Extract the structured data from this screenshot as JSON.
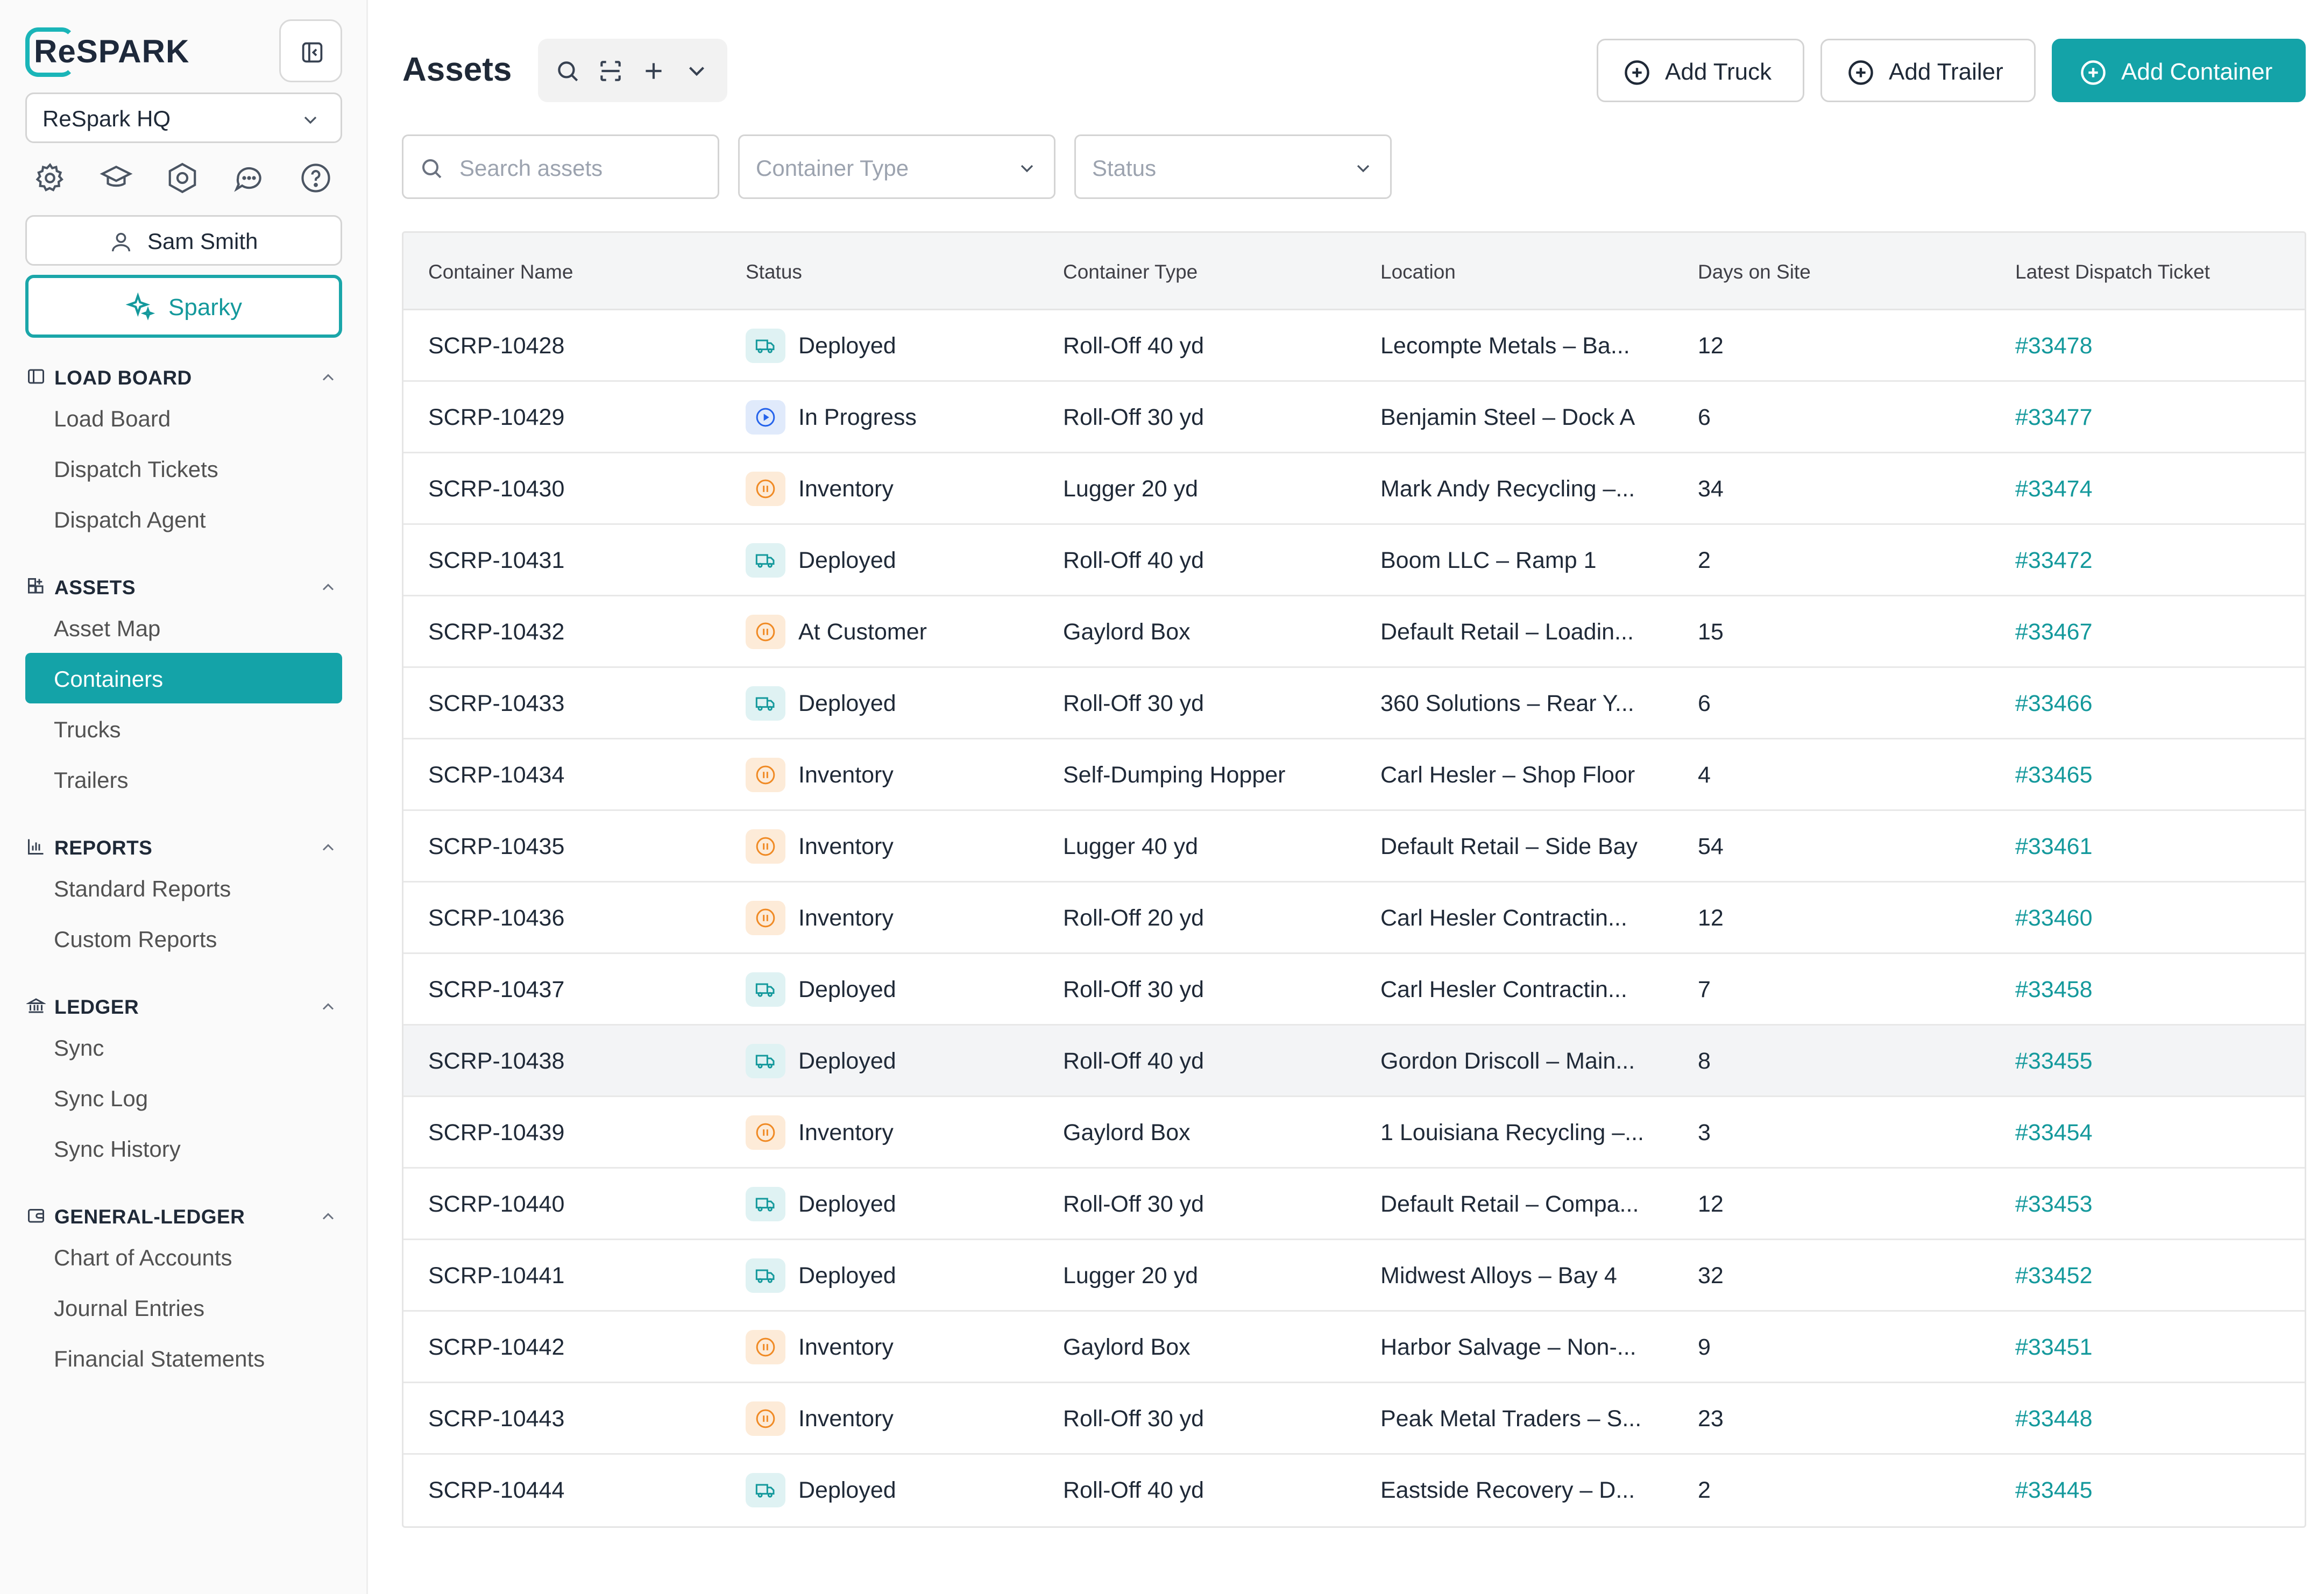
{
  "brand": {
    "logo_text": "ReSPARK",
    "accent": "#14a3a8"
  },
  "sidebar": {
    "org": "ReSpark HQ",
    "user": "Sam Smith",
    "sparky": "Sparky",
    "util_icons": [
      "settings-icon",
      "graduation-cap-icon",
      "hexagon-settings-icon",
      "chat-icon",
      "help-icon"
    ],
    "sections": [
      {
        "title": "LOAD BOARD",
        "icon": "panel-icon",
        "items": [
          "Load Board",
          "Dispatch Tickets",
          "Dispatch Agent"
        ]
      },
      {
        "title": "ASSETS",
        "icon": "grid-plus-icon",
        "items": [
          "Asset Map",
          "Containers",
          "Trucks",
          "Trailers"
        ]
      },
      {
        "title": "REPORTS",
        "icon": "bar-chart-icon",
        "items": [
          "Standard Reports",
          "Custom Reports"
        ]
      },
      {
        "title": "LEDGER",
        "icon": "bank-icon",
        "items": [
          "Sync",
          "Sync Log",
          "Sync History"
        ]
      },
      {
        "title": "GENERAL-LEDGER",
        "icon": "wallet-icon",
        "items": [
          "Chart of Accounts",
          "Journal Entries",
          "Financial Statements"
        ]
      }
    ],
    "active_item": "Containers"
  },
  "header": {
    "title": "Assets",
    "add_truck": "Add Truck",
    "add_trailer": "Add Trailer",
    "add_container": "Add Container"
  },
  "filters": {
    "search_placeholder": "Search assets",
    "container_type": "Container Type",
    "status": "Status"
  },
  "table": {
    "columns": [
      "Container Name",
      "Status",
      "Container Type",
      "Location",
      "Days on Site",
      "Latest Dispatch Ticket"
    ],
    "rows": [
      {
        "name": "SCRP-10428",
        "status": "Deployed",
        "kind": "deployed",
        "type": "Roll-Off 40 yd",
        "location": "Lecompte Metals – Ba...",
        "days": "12",
        "ticket": "#33478"
      },
      {
        "name": "SCRP-10429",
        "status": "In Progress",
        "kind": "progress",
        "type": "Roll-Off 30 yd",
        "location": "Benjamin Steel – Dock A",
        "days": "6",
        "ticket": "#33477"
      },
      {
        "name": "SCRP-10430",
        "status": "Inventory",
        "kind": "inventory",
        "type": "Lugger 20 yd",
        "location": "Mark Andy Recycling –...",
        "days": "34",
        "ticket": "#33474"
      },
      {
        "name": "SCRP-10431",
        "status": "Deployed",
        "kind": "deployed",
        "type": "Roll-Off 40 yd",
        "location": "Boom LLC – Ramp 1",
        "days": "2",
        "ticket": "#33472"
      },
      {
        "name": "SCRP-10432",
        "status": "At Customer",
        "kind": "inventory",
        "type": "Gaylord Box",
        "location": "Default Retail – Loadin...",
        "days": "15",
        "ticket": "#33467"
      },
      {
        "name": "SCRP-10433",
        "status": "Deployed",
        "kind": "deployed",
        "type": "Roll-Off 30 yd",
        "location": "360 Solutions – Rear Y...",
        "days": "6",
        "ticket": "#33466"
      },
      {
        "name": "SCRP-10434",
        "status": "Inventory",
        "kind": "inventory",
        "type": "Self-Dumping Hopper",
        "location": "Carl Hesler – Shop Floor",
        "days": "4",
        "ticket": "#33465"
      },
      {
        "name": "SCRP-10435",
        "status": "Inventory",
        "kind": "inventory",
        "type": "Lugger 40 yd",
        "location": "Default Retail – Side Bay",
        "days": "54",
        "ticket": "#33461"
      },
      {
        "name": "SCRP-10436",
        "status": "Inventory",
        "kind": "inventory",
        "type": "Roll-Off 20 yd",
        "location": "Carl Hesler Contractin...",
        "days": "12",
        "ticket": "#33460"
      },
      {
        "name": "SCRP-10437",
        "status": "Deployed",
        "kind": "deployed",
        "type": "Roll-Off 30 yd",
        "location": "Carl Hesler Contractin...",
        "days": "7",
        "ticket": "#33458"
      },
      {
        "name": "SCRP-10438",
        "status": "Deployed",
        "kind": "deployed",
        "type": "Roll-Off 40 yd",
        "location": "Gordon Driscoll – Main...",
        "days": "8",
        "ticket": "#33455"
      },
      {
        "name": "SCRP-10439",
        "status": "Inventory",
        "kind": "inventory",
        "type": "Gaylord Box",
        "location": "1 Louisiana Recycling –...",
        "days": "3",
        "ticket": "#33454"
      },
      {
        "name": "SCRP-10440",
        "status": "Deployed",
        "kind": "deployed",
        "type": "Roll-Off 30 yd",
        "location": "Default Retail – Compa...",
        "days": "12",
        "ticket": "#33453"
      },
      {
        "name": "SCRP-10441",
        "status": "Deployed",
        "kind": "deployed",
        "type": "Lugger 20 yd",
        "location": "Midwest Alloys – Bay 4",
        "days": "32",
        "ticket": "#33452"
      },
      {
        "name": "SCRP-10442",
        "status": "Inventory",
        "kind": "inventory",
        "type": "Gaylord Box",
        "location": "Harbor Salvage – Non-...",
        "days": "9",
        "ticket": "#33451"
      },
      {
        "name": "SCRP-10443",
        "status": "Inventory",
        "kind": "inventory",
        "type": "Roll-Off 30 yd",
        "location": "Peak Metal Traders – S...",
        "days": "23",
        "ticket": "#33448"
      },
      {
        "name": "SCRP-10444",
        "status": "Deployed",
        "kind": "deployed",
        "type": "Roll-Off 40 yd",
        "location": "Eastside Recovery – D...",
        "days": "2",
        "ticket": "#33445"
      }
    ],
    "hovered_row": "SCRP-10438"
  }
}
